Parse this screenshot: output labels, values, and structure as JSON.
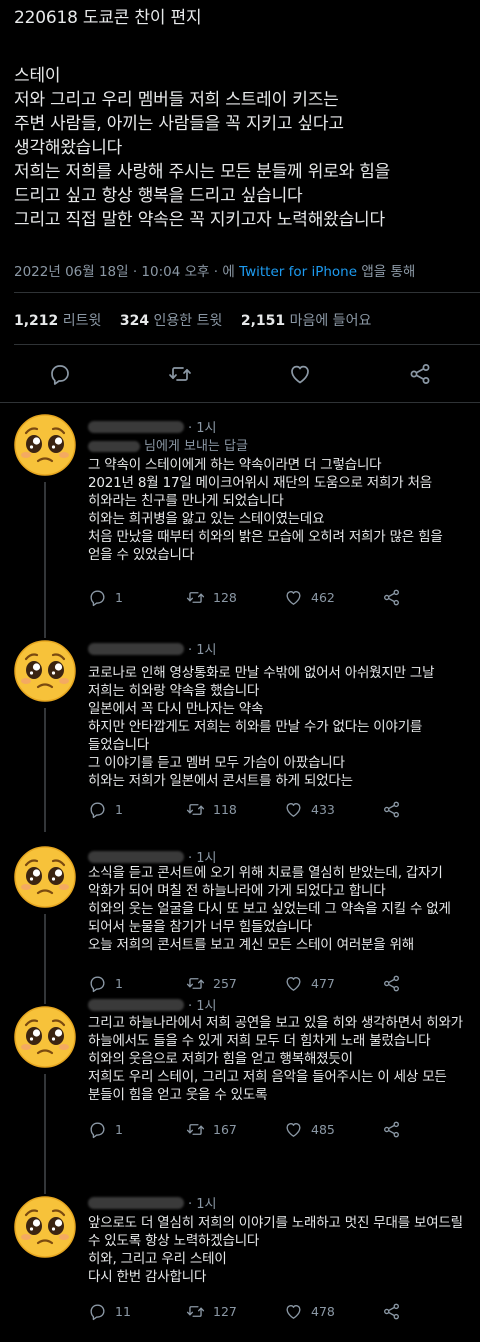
{
  "main_tweet": {
    "lines": [
      "220618 도쿄콘 찬이 편지",
      "스테이",
      "저와 그리고 우리 멤버들 저희 스트레이 키즈는",
      "주변 사람들, 아끼는 사람들을 꼭 지키고 싶다고",
      "생각해왔습니다",
      "저희는 저희를 사랑해 주시는 모든 분들께 위로와 힘을",
      "드리고 싶고 항상 행복을 드리고 싶습니다",
      "그리고 직접 말한 약속은 꼭 지키고자 노력해왔습니다"
    ],
    "meta_date": "2022년 06월 18일 · 10:04 오후 · 에",
    "meta_source": "Twitter for iPhone",
    "meta_suffix": "앱을 통해",
    "stats": {
      "retweets": "1,212",
      "retweets_label": "리트윗",
      "quotes": "324",
      "quotes_label": "인용한 트윗",
      "likes": "2,151",
      "likes_label": "마음에 들어요"
    }
  },
  "replies": [
    {
      "time": "· 1시",
      "replying_to": "님에게 보내는 답글",
      "lines": [
        "그 약속이 스테이에게 하는 약속이라면 더 그렇습니다",
        "2021년 8월 17일 메이크어위시 재단의 도움으로 저희가 처음",
        "히와라는 친구를 만나게 되었습니다",
        "히와는 희귀병을 앓고 있는 스테이였는데요",
        "처음 만났을 때부터 히와의 밝은 모습에 오히려 저희가 많은 힘을",
        "얻을 수 있었습니다"
      ],
      "replies": "1",
      "retweets": "128",
      "likes": "462"
    },
    {
      "time": "· 1시",
      "lines": [
        "코로나로 인해 영상통화로 만날 수밖에 없어서 아쉬웠지만 그날",
        "저희는 히와랑 약속을 했습니다",
        "일본에서 꼭 다시 만나자는 약속",
        "하지만 안타깝게도 저희는 히와를 만날 수가 없다는 이야기를",
        "들었습니다",
        "그 이야기를 듣고 멤버 모두 가슴이 아팠습니다",
        "히와는 저희가 일본에서 콘서트를 하게 되었다는"
      ],
      "replies": "1",
      "retweets": "118",
      "likes": "433"
    },
    {
      "time": "· 1시",
      "lines": [
        "소식을 듣고 콘서트에 오기 위해 치료를 열심히 받았는데, 갑자기",
        "악화가 되어 며칠 전 하늘나라에 가게 되었다고 합니다",
        "히와의 웃는 얼굴을 다시 또 보고 싶었는데 그 약속을 지킬 수 없게",
        "되어서 눈물을 참기가 너무 힘들었습니다",
        "오늘 저희의 콘서트를 보고 계신 모든 스테이 여러분을 위해"
      ],
      "replies": "1",
      "retweets": "257",
      "likes": "477"
    },
    {
      "time": "· 1시",
      "lines": [
        "그리고 하늘나라에서 저희 공연을 보고 있을 히와 생각하면서 히와가",
        "하늘에서도 들을 수 있게 저희 모두 더 힘차게 노래 불렀습니다",
        "히와의 웃음으로 저희가 힘을 얻고 행복해졌듯이",
        "저희도 우리 스테이, 그리고 저희 음악을 들어주시는 이 세상 모든",
        "분들이 힘을 얻고 웃을 수 있도록"
      ],
      "replies": "1",
      "retweets": "167",
      "likes": "485"
    },
    {
      "time": "· 1시",
      "lines": [
        "앞으로도 더 열심히 저희의 이야기를 노래하고 멋진 무대를 보여드릴",
        "수 있도록 항상 노력하겠습니다",
        "히와, 그리고 우리 스테이",
        "다시 한번 감사합니다"
      ],
      "replies": "11",
      "retweets": "127",
      "likes": "478"
    }
  ],
  "icons": {
    "reply": "reply-icon",
    "retweet": "retweet-icon",
    "like": "heart-icon",
    "share": "share-icon",
    "avatar": "pleading-face-emoji"
  },
  "colors": {
    "background": "#000000",
    "text": "#e7e9ea",
    "muted": "#8b98a5",
    "link": "#1d9bf0",
    "emoji": "#f7c23a"
  }
}
